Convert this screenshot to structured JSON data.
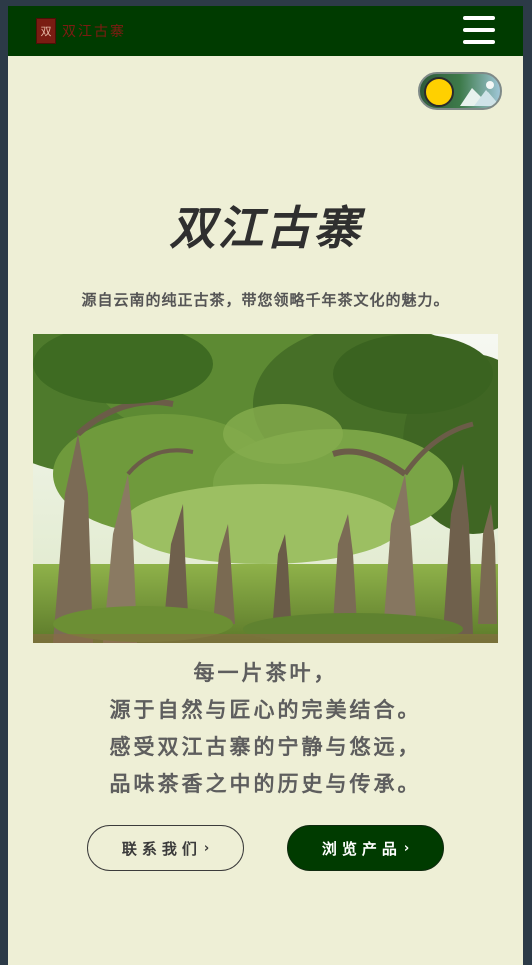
{
  "header": {
    "logo_seal": "双",
    "logo_text": "双江古寨",
    "menu_icon": "hamburger-menu-icon"
  },
  "theme_toggle": {
    "state": "light",
    "knob_color": "#ffd000"
  },
  "hero": {
    "title": "双江古寨",
    "subtitle": "源自云南的纯正古茶，带您领略千年茶文化的魅力。",
    "image_alt": "古茶树林"
  },
  "poem": {
    "lines": [
      "每一片茶叶，",
      "源于自然与匠心的完美结合。",
      "感受双江古寨的宁静与悠远，",
      "品味茶香之中的历史与传承。"
    ]
  },
  "buttons": {
    "contact_label": "联系我们",
    "browse_label": "浏览产品",
    "chevron": "›"
  },
  "colors": {
    "header_bg": "#003b00",
    "page_bg": "#eeefd6",
    "accent": "#003b00",
    "logo_red": "#7a1c12"
  }
}
